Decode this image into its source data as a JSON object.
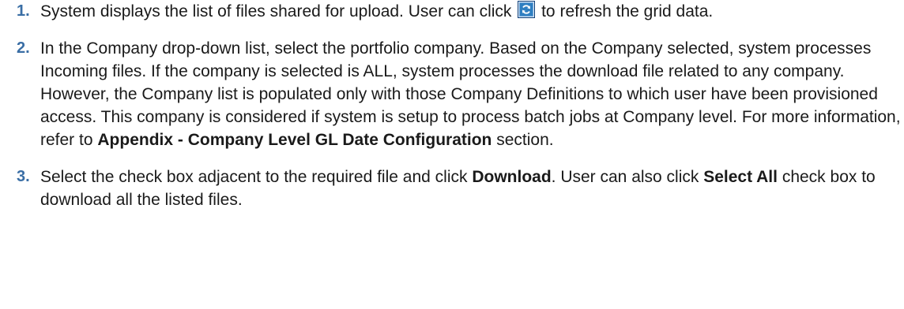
{
  "steps": [
    {
      "number": "1.",
      "text_before_icon": "System displays the list of files shared for upload. User can click ",
      "icon": "refresh-icon",
      "text_after_icon": " to refresh the grid data."
    },
    {
      "number": "2.",
      "para1": "In the Company drop-down list, select the portfolio company. Based on the Company selected, system processes Incoming files. If the company is selected is ALL, system processes the download file related to any company.",
      "para2_before_bold": "However, the Company list is populated only with those Company Definitions to which user have been provisioned access. This company is considered if system is setup to process batch jobs at Company level. For more information, refer to ",
      "para2_bold": "Appendix - Company Level GL Date Configuration",
      "para2_after_bold": " section."
    },
    {
      "number": "3.",
      "text_before_bold1": "Select the check box adjacent to the required file and click ",
      "bold1": "Download",
      "text_between": ". User can also click ",
      "bold2": "Select All",
      "text_after": " check box to download all the listed files."
    }
  ],
  "colors": {
    "step_number": "#3a6ea5",
    "text": "#1a1a1a",
    "icon_background": "#2f7fc1",
    "icon_border": "#0d3f7a"
  }
}
